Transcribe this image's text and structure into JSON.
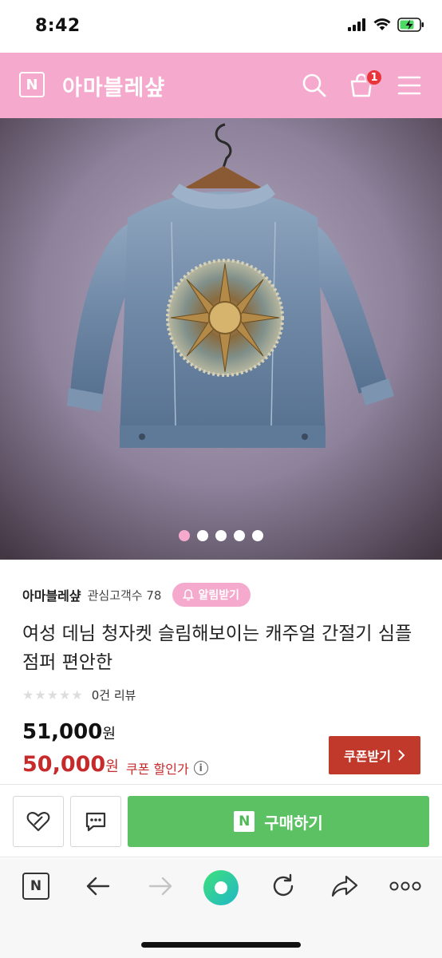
{
  "status_bar": {
    "time": "8:42"
  },
  "header": {
    "logo_letter": "N",
    "store_title": "아마블레샾",
    "cart_count": "1"
  },
  "hero": {
    "slide_count": 5,
    "active_slide": 0
  },
  "product": {
    "store_name": "아마블레샾",
    "follower_text": "관심고객수 78",
    "alarm_label": "알림받기",
    "title": "여성 데님 청자켓 슬림해보이는 캐주얼 간절기 심플 점퍼 편안한",
    "stars": "★★★★★",
    "review_count": "0건 리뷰",
    "original_price": "51,000",
    "sale_price": "50,000",
    "currency": "원",
    "coupon_discount_label": "쿠폰 할인가",
    "coupon_button_label": "쿠폰받기"
  },
  "purchase": {
    "buy_logo_letter": "N",
    "buy_label": "구매하기"
  },
  "toolbar": {
    "home_letter": "N"
  },
  "colors": {
    "brand_pink": "#f4a9cd",
    "buy_green": "#5bc163",
    "sale_red": "#c62a2a",
    "coupon_red": "#c0392b"
  }
}
